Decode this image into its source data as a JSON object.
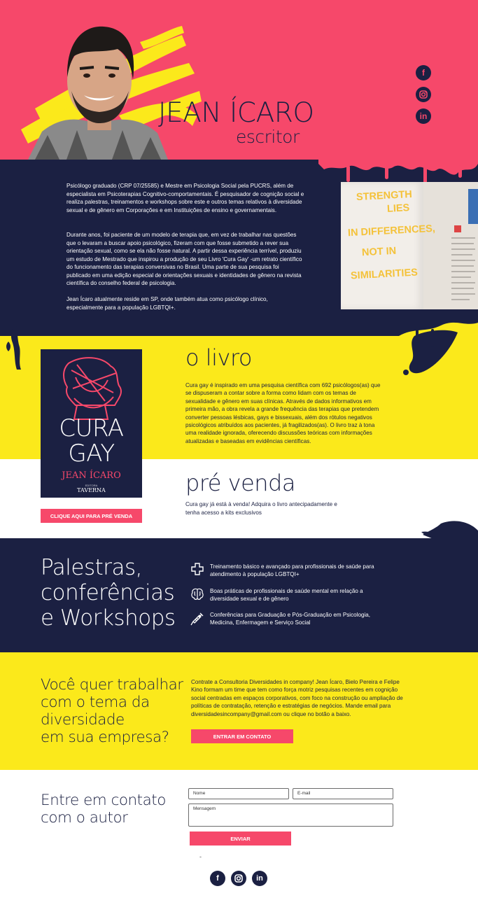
{
  "hero": {
    "name": "JEAN ÍCARO",
    "subtitle": "escritor",
    "social": [
      "facebook-icon",
      "instagram-icon",
      "linkedin-icon"
    ]
  },
  "bio": {
    "paragraphs": [
      "Psicólogo graduado (CRP 07/25585) e Mestre em Psicologia Social pela PUCRS, além de especialista em Psicoterapias Cognitivo-comportamentais. É pesquisador de cognição social e realiza palestras, treinamentos e workshops sobre este e outros temas relativos à diversidade sexual e de gênero em Corporações e em Instituições de ensino e governamentais.",
      "Durante anos, foi paciente de um modelo de terapia que, em vez de trabalhar nas questões que o levaram a buscar apoio psicológico, fizeram com que fosse submetido a rever sua orientação sexual, como se ela não fosse natural. A partir dessa experiência terrível, produziu um estudo de Mestrado que inspirou a produção de seu Livro 'Cura Gay' -um retrato científico do funcionamento das terapias conversivas no Brasil. Uma parte de sua pesquisa foi publicado em uma edição especial de orientações sexuais e identidades de gênero na revista científica do conselho federal de psicologia.",
      "Jean Ícaro atualmente reside em SP, onde também atua como psicólogo clínico, especialmente para a população LGBTQI+."
    ],
    "photo_quote": [
      "STRENGTH",
      "LIES",
      "IN DIFFERENCES,",
      "NOT IN",
      "SIMILARITIES"
    ]
  },
  "book": {
    "title": "o livro",
    "text": "Cura gay é inspirado em uma pesquisa científica com 692 psicólogos(as) que se dispuseram a contar sobre a forma como lidam com os temas de sexualidade e gênero em suas clínicas. Através de dados informativos em primeira mão, a obra revela a grande frequência das terapias que pretendem converter pessoas lésbicas, gays e bissexuais, além dos rótulos negativos psicológicos atribuídos aos pacientes, já fragilizados(as). O livro traz à tona uma realidade ignorada, oferecendo discussões teóricas com informações atualizadas e baseadas em evidências científicas.",
    "cover_title_1": "CURA",
    "cover_title_2": "GAY",
    "cover_author": "JEAN ÍCARO",
    "cover_publisher_small": "EDITORA",
    "cover_publisher": "TAVERNA",
    "presale_title": "pré venda",
    "presale_text": "Cura gay já está à venda! Adquira o livro antecipadamente e tenha acesso a kits exclusivos",
    "presale_button": "CLIQUE AQUI PARA PRÉ VENDA"
  },
  "talks": {
    "title_lines": [
      "Palestras,",
      "conferências",
      "e Workshops"
    ],
    "items": [
      {
        "icon": "medical-cross-icon",
        "text": "Treinamento básico e avançado para profissionais de saúde para atendimento à população LGBTQI+"
      },
      {
        "icon": "brain-icon",
        "text": "Boas práticas de profissionais de saúde mental em relação a diversidade sexual e de gênero"
      },
      {
        "icon": "syringe-icon",
        "text": "Conferências para Graduação e Pós-Graduação em Psicologia, Medicina, Enfermagem e Serviço Social"
      }
    ]
  },
  "consulting": {
    "title_lines": [
      "Você quer trabalhar",
      "com o tema da",
      "diversidade",
      "em sua empresa?"
    ],
    "text": "Contrate a Consultoria Diversidades in company! Jean Ícaro, Bielo Pereira e Felipe Kino formam um time que tem como força motriz pesquisas recentes em cognição social centradas em espaços corporativos, com foco na construção ou ampliação de políticas de contratação, retenção e estratégias de negócios. Mande email para diversidadesincompany@gmail.com ou clique no botão a baixo.",
    "button": "ENTRAR EM CONTATO"
  },
  "contact": {
    "title_lines": [
      "Entre em contato",
      "com o autor"
    ],
    "name_placeholder": "Nome",
    "email_placeholder": "E-mail",
    "message_placeholder": "Mensagem",
    "submit": "ENVIAR",
    "dash": "-",
    "social": [
      "facebook-icon",
      "instagram-icon",
      "linkedin-icon"
    ]
  },
  "colors": {
    "pink": "#f6486a",
    "navy": "#1b2042",
    "yellow": "#fbe91b"
  }
}
